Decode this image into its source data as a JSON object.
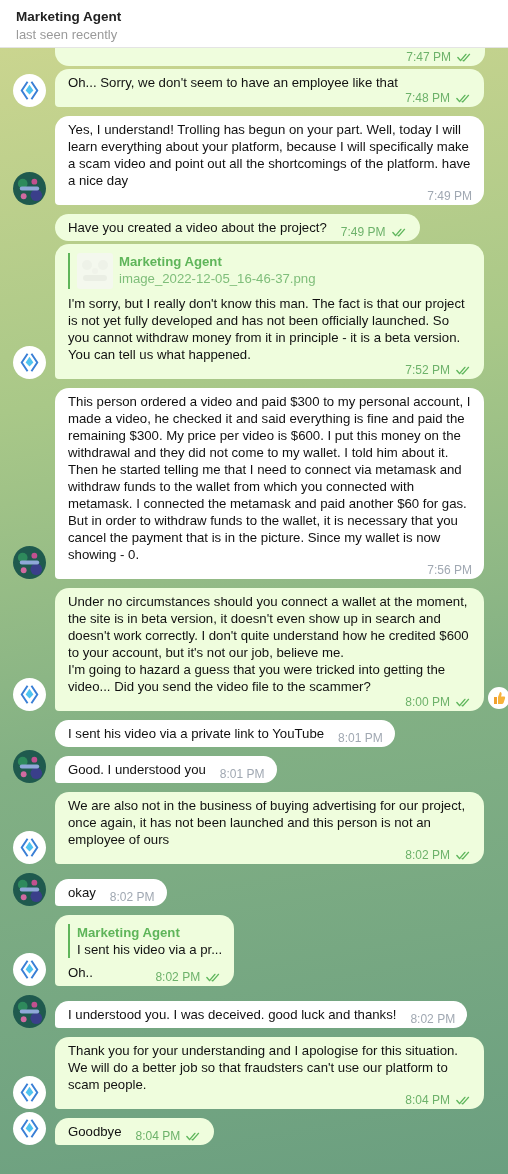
{
  "header": {
    "title": "Marketing Agent",
    "status": "last seen recently"
  },
  "messages": [
    {
      "kind": "out",
      "cut": true,
      "time": "7:47 PM",
      "read": true,
      "avatar": false
    },
    {
      "kind": "out",
      "text": "Oh... Sorry, we don't seem to have an employee like that",
      "time": "7:48 PM",
      "read": true,
      "avatar": true
    },
    {
      "kind": "in",
      "text": "Yes, I understand! Trolling has begun on your part. Well, today I will learn everything about your platform, because I will specifically make a scam video and point out all the shortcomings of the platform. have a nice day",
      "time": "7:49 PM",
      "avatar": true
    },
    {
      "kind": "out",
      "text": "Have you created a video about the project?",
      "time": "7:49 PM",
      "read": true,
      "avatar": false
    },
    {
      "kind": "out",
      "reply": {
        "author": "Marketing Agent",
        "text": "image_2022-12-05_16-46-37.png"
      },
      "text": "I'm sorry, but I really don't know this man. The fact is that our project is not yet fully developed and has not been officially launched. So you cannot withdraw money from it in principle - it is a beta version. You can tell us what happened.",
      "time": "7:52 PM",
      "read": true,
      "avatar": true
    },
    {
      "kind": "in",
      "text": "This person ordered a video and paid $300 to my personal account, I made a video, he checked it and said everything is fine and paid the remaining $300. My price per video is $600. I put this money on the withdrawal and they did not come to my wallet. I told him about it. Then he started telling me that I need to connect via metamask and withdraw funds to the wallet from which you connected with metamask. I connected the metamask and paid another $60 for gas. But in order to withdraw funds to the wallet, it is necessary that you cancel the payment that is in the picture. Since my wallet is now showing - 0.",
      "time": "7:56 PM",
      "avatar": true
    },
    {
      "kind": "out",
      "text": "Under no circumstances should you connect a wallet at the moment, the site is in beta version, it doesn't even show up in search and doesn't work correctly. I don't quite understand how he credited $600 to your account, but it's not our job, believe me.\nI'm going to hazard a guess that you were tricked into getting the video... Did you send the video file to the scammer?",
      "time": "8:00 PM",
      "read": true,
      "avatar": true,
      "reacted": true
    },
    {
      "kind": "in",
      "text": "I sent his video via a private link to YouTube",
      "time": "8:01 PM",
      "avatar": false
    },
    {
      "kind": "in",
      "text": "Good. I understood you",
      "time": "8:01 PM",
      "avatar": true
    },
    {
      "kind": "out",
      "text": "We are also not in the business of buying advertising for our project, once again, it has not been launched and this person is not an employee of ours",
      "time": "8:02 PM",
      "read": true,
      "avatar": true
    },
    {
      "kind": "in",
      "text": "okay",
      "time": "8:02 PM",
      "avatar": true
    },
    {
      "kind": "out",
      "reply": {
        "kind": "text",
        "author": "Marketing Agent",
        "text": "I sent his video via a pr..."
      },
      "text": "Oh..",
      "time": "8:02 PM",
      "read": true,
      "avatar": true
    },
    {
      "kind": "in",
      "text": "I understood you. I was deceived. good luck and thanks!",
      "time": "8:02 PM",
      "avatar": true
    },
    {
      "kind": "out",
      "text": "Thank you for your understanding and I apologise for this situation. We will do a better job so that fraudsters can't use our platform to scam people.",
      "time": "8:04 PM",
      "read": true,
      "avatar": true
    },
    {
      "kind": "out",
      "text": "Goodbye",
      "time": "8:04 PM",
      "read": true,
      "avatar": true
    }
  ]
}
